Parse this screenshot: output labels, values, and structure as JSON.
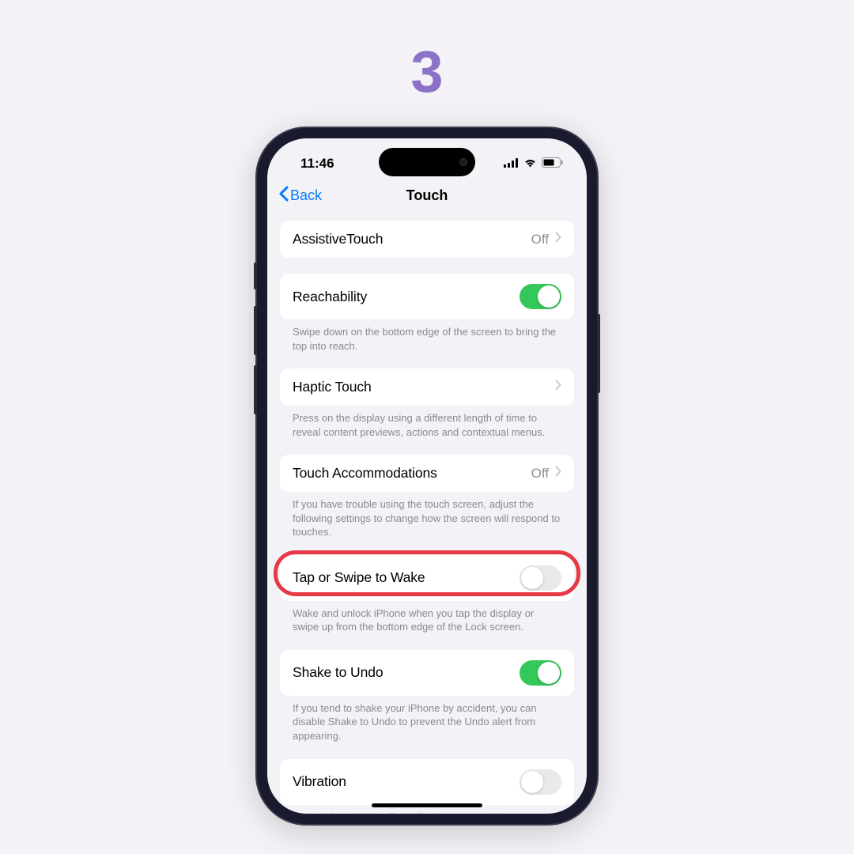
{
  "step_number": "3",
  "status": {
    "time": "11:46"
  },
  "nav": {
    "back_label": "Back",
    "title": "Touch"
  },
  "groups": {
    "assistive": {
      "label": "AssistiveTouch",
      "value": "Off"
    },
    "reachability": {
      "label": "Reachability",
      "on": true,
      "footer": "Swipe down on the bottom edge of the screen to bring the top into reach."
    },
    "haptic": {
      "label": "Haptic Touch",
      "footer": "Press on the display using a different length of time to reveal content previews, actions and contextual menus."
    },
    "accommodations": {
      "label": "Touch Accommodations",
      "value": "Off",
      "footer": "If you have trouble using the touch screen, adjust the following settings to change how the screen will respond to touches."
    },
    "tapwake": {
      "label": "Tap or Swipe to Wake",
      "on": false,
      "footer": "Wake and unlock iPhone when you tap the display or swipe up from the bottom edge of the Lock screen."
    },
    "shake": {
      "label": "Shake to Undo",
      "on": true,
      "footer": "If you tend to shake your iPhone by accident, you can disable Shake to Undo to prevent the Undo alert from appearing."
    },
    "vibration": {
      "label": "Vibration",
      "on": false,
      "footer": "When this switch is off, all vibration on your iPhone"
    }
  }
}
